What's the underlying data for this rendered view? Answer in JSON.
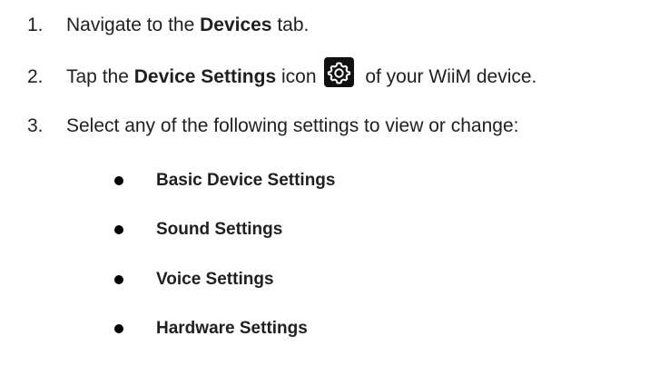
{
  "steps": [
    {
      "number": "1.",
      "pre": "Navigate to the ",
      "bold": "Devices",
      "post": " tab."
    },
    {
      "number": "2.",
      "pre": "Tap the ",
      "bold": "Device Settings",
      "mid": " icon",
      "post": " of your WiiM device.",
      "icon": "gear-icon"
    },
    {
      "number": "3.",
      "text": "Select any of the following settings to view or change:"
    }
  ],
  "settings_list": [
    {
      "label": "Basic Device Settings"
    },
    {
      "label": "Sound Settings"
    },
    {
      "label": "Voice Settings"
    },
    {
      "label": "Hardware Settings"
    }
  ]
}
